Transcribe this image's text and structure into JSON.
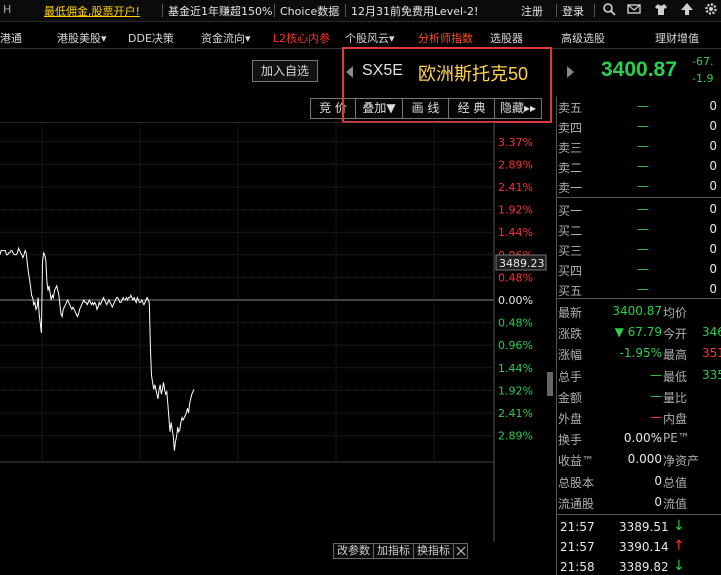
{
  "topbar": {
    "logo": "H",
    "promo": "最低佣金,股票开户!",
    "fund": "基金近1年赚超150%",
    "choice": "Choice数据",
    "level2": "12月31前免费用Level-2!",
    "register": "注册",
    "login": "登录",
    "icons": [
      "search-icon",
      "mail-icon",
      "shirt-icon",
      "shirt-icon",
      "upload-icon",
      "gear-icon"
    ]
  },
  "menu": [
    {
      "label": "港通",
      "color": "normal"
    },
    {
      "label": "港股美股▾",
      "color": "normal"
    },
    {
      "label": "DDE决策",
      "color": "normal"
    },
    {
      "label": "资金流向▾",
      "color": "normal"
    },
    {
      "label": "L2核心内参",
      "color": "red"
    },
    {
      "label": "个股风云▾",
      "color": "normal"
    },
    {
      "label": "分析师指数",
      "color": "orange"
    },
    {
      "label": "选股器",
      "color": "normal"
    },
    {
      "label": "高级选股",
      "color": "normal"
    },
    {
      "label": "理财增值",
      "color": "normal"
    }
  ],
  "add_watch": "加入自选",
  "instrument": {
    "code": "SX5E",
    "name": "欧洲斯托克50",
    "price": "3400.87",
    "change": "-67.",
    "change_pct": "-1.9"
  },
  "tools": [
    "竞 价",
    "叠加▼",
    "画 线",
    "经 典",
    "隐藏▸▸"
  ],
  "chart": {
    "pct_labels_red": [
      "3.37%",
      "2.89%",
      "2.41%",
      "1.92%",
      "1.44%",
      "0.96%",
      "0.48%"
    ],
    "zero_label": "0.00%",
    "pct_labels_green": [
      "0.48%",
      "0.96%",
      "1.44%",
      "1.92%",
      "2.41%",
      "2.89%"
    ],
    "cursor_value": "3489.23"
  },
  "bottom_tools": [
    "改参数",
    "加指标",
    "换指标"
  ],
  "orderbook": {
    "asks": [
      {
        "label": "卖五",
        "price": "—",
        "qty": "0"
      },
      {
        "label": "卖四",
        "price": "—",
        "qty": "0"
      },
      {
        "label": "卖三",
        "price": "—",
        "qty": "0"
      },
      {
        "label": "卖二",
        "price": "—",
        "qty": "0"
      },
      {
        "label": "卖一",
        "price": "—",
        "qty": "0"
      }
    ],
    "bids": [
      {
        "label": "买一",
        "price": "—",
        "qty": "0"
      },
      {
        "label": "买二",
        "price": "—",
        "qty": "0"
      },
      {
        "label": "买三",
        "price": "—",
        "qty": "0"
      },
      {
        "label": "买四",
        "price": "—",
        "qty": "0"
      },
      {
        "label": "买五",
        "price": "—",
        "qty": "0"
      }
    ]
  },
  "stats": [
    {
      "l1": "最新",
      "v1": "3400.87",
      "c1": "green",
      "l2": "均价",
      "v2": ""
    },
    {
      "l1": "涨跌",
      "v1": "▼ 67.79",
      "c1": "green",
      "l2": "今开",
      "v2": "346",
      "c2": "green"
    },
    {
      "l1": "涨幅",
      "v1": "-1.95%",
      "c1": "green",
      "l2": "最高",
      "v2": "351",
      "c2": "red"
    },
    {
      "l1": "总手",
      "v1": "—",
      "c1": "green",
      "l2": "最低",
      "v2": "335",
      "c2": "green"
    },
    {
      "l1": "金额",
      "v1": "—",
      "c1": "green",
      "l2": "量比",
      "v2": ""
    },
    {
      "l1": "外盘",
      "v1": "—",
      "c1": "red",
      "l2": "内盘",
      "v2": ""
    },
    {
      "l1": "换手",
      "v1": "0.00%",
      "c1": "normal",
      "l2": "PE™",
      "v2": ""
    },
    {
      "l1": "收益™",
      "v1": "0.000",
      "c1": "normal",
      "l2": "净资产",
      "v2": ""
    },
    {
      "l1": "总股本",
      "v1": "0",
      "c1": "normal",
      "l2": "总值",
      "v2": ""
    },
    {
      "l1": "流通股",
      "v1": "0",
      "c1": "normal",
      "l2": "流值",
      "v2": ""
    }
  ],
  "ticks": [
    {
      "time": "21:57",
      "price": "3389.51",
      "arrow": "↓",
      "dir": "down"
    },
    {
      "time": "21:57",
      "price": "3390.14",
      "arrow": "↑",
      "dir": "up"
    },
    {
      "time": "21:58",
      "price": "3389.82",
      "arrow": "↓",
      "dir": "down"
    }
  ],
  "chart_data": {
    "type": "line",
    "title": "",
    "xlabel": "",
    "ylabel": "",
    "ylim": [
      -2.89,
      3.37
    ],
    "series": [
      {
        "values": [
          0.96,
          1.05,
          1.05,
          1.05,
          1.05,
          1.05,
          0.96,
          0.96,
          1.0,
          1.0,
          1.05,
          1.05,
          1.0,
          0.96,
          0.96,
          0.96,
          1.0,
          1.1,
          1.05,
          1.0,
          0.96,
          0.9,
          0.96,
          1.05,
          1.0,
          0.8,
          0.6,
          0.45,
          0.3,
          0.1,
          0.05,
          -0.1,
          -0.05,
          -0.2,
          -0.15,
          0.05,
          -0.3,
          -0.5,
          -0.7,
          0.8,
          1.0,
          0.96,
          0.85,
          0.4,
          0.2,
          0.3,
          0.15,
          0.0,
          0.1,
          0.05,
          0.2,
          0.25,
          0.3,
          0.2,
          0.1,
          -0.1,
          -0.3,
          -0.35,
          -0.2,
          -0.15,
          -0.1,
          -0.05,
          0.0,
          -0.05,
          -0.1,
          -0.15,
          -0.2,
          -0.15,
          -0.2,
          -0.25,
          -0.3,
          -0.35,
          -0.3,
          -0.2,
          -0.15,
          -0.1,
          -0.05,
          0.0,
          -0.05,
          -0.05,
          -0.1,
          -0.05,
          0.0,
          -0.05,
          -0.1,
          -0.05,
          -0.1,
          -0.05,
          -0.1,
          -0.2,
          -0.15,
          -0.05,
          -0.1,
          -0.05,
          0.0,
          0.05,
          0.0,
          -0.05,
          -0.1,
          -0.05,
          0.0,
          -0.05,
          -0.1,
          -0.15,
          -0.1,
          -0.05,
          0.0,
          0.05,
          0.05,
          0.0,
          -0.05,
          -0.05,
          0.0,
          0.05,
          0.0,
          0.0,
          0.05,
          0.0,
          0.05,
          0.05,
          0.1,
          0.05,
          0.0,
          0.05,
          0.0,
          -0.05,
          0.05,
          0.0,
          -0.05,
          -0.05,
          0.0,
          -0.05,
          -0.1,
          -0.05,
          0.0,
          0.05,
          0.0,
          -0.05,
          -1.0,
          -1.6,
          -1.75,
          -1.9,
          -1.8,
          -1.9,
          -2.0,
          -2.1,
          -1.9,
          -1.8,
          -2.0,
          -1.9,
          -1.75,
          -1.9,
          -2.0,
          -1.95,
          -2.2,
          -2.5,
          -2.8,
          -2.6,
          -2.75,
          -2.9,
          -3.2,
          -3.0,
          -2.9,
          -2.7,
          -2.8,
          -2.75,
          -2.6,
          -2.5,
          -2.55,
          -2.5,
          -2.45,
          -2.4,
          -2.3,
          -2.4,
          -2.2,
          -2.1,
          -2.0,
          -1.95,
          -1.9
        ]
      }
    ]
  }
}
